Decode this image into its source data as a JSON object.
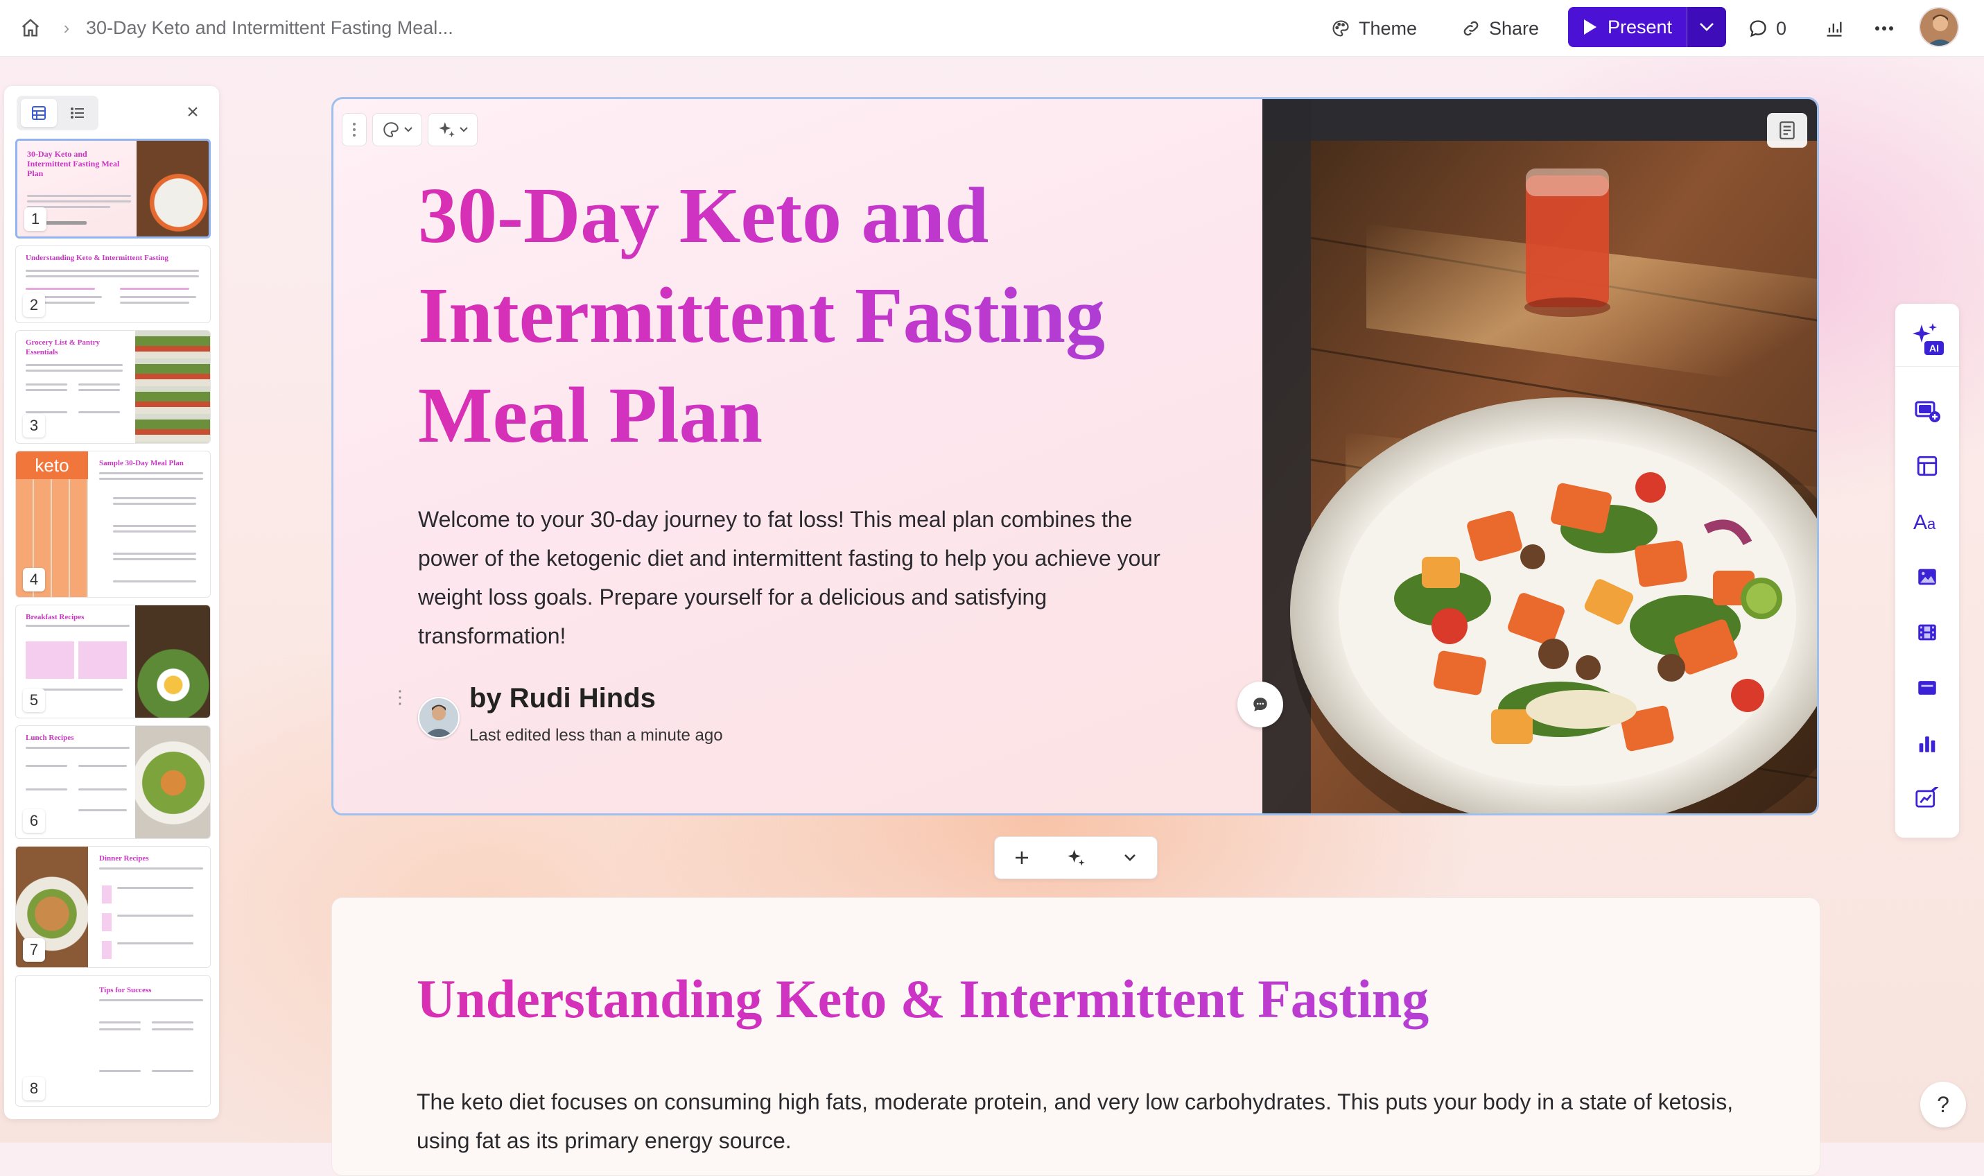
{
  "topbar": {
    "doc_title": "30-Day Keto and Intermittent Fasting Meal...",
    "theme_label": "Theme",
    "share_label": "Share",
    "present_label": "Present",
    "comment_count": "0"
  },
  "thumbnails": [
    {
      "num": "1",
      "title": "30-Day Keto and Intermittent Fasting Meal Plan"
    },
    {
      "num": "2",
      "title": "Understanding Keto & Intermittent Fasting"
    },
    {
      "num": "3",
      "title": "Grocery List & Pantry Essentials"
    },
    {
      "num": "4",
      "title": "Sample 30-Day Meal Plan",
      "badge": "keto"
    },
    {
      "num": "5",
      "title": "Breakfast Recipes"
    },
    {
      "num": "6",
      "title": "Lunch Recipes"
    },
    {
      "num": "7",
      "title": "Dinner Recipes"
    },
    {
      "num": "8",
      "title": "Tips for Success"
    }
  ],
  "slide1": {
    "title": "30-Day Keto and Intermittent Fasting Meal Plan",
    "body": "Welcome to your 30-day journey to fat loss! This meal plan combines the power of the ketogenic diet and intermittent fasting to help you achieve your weight loss goals. Prepare yourself for a delicious and satisfying transformation!",
    "author": "by Rudi Hinds",
    "edited": "Last edited less than a minute ago"
  },
  "slide2": {
    "title": "Understanding Keto & Intermittent Fasting",
    "body": "The keto diet focuses on consuming high fats, moderate protein, and very low carbohydrates. This puts your body in a state of ketosis, using fat as its primary energy source."
  },
  "help_label": "?",
  "colors": {
    "accent": "#4b12d6",
    "title_pink": "#d92fb3",
    "title_purple": "#a93fd6"
  }
}
